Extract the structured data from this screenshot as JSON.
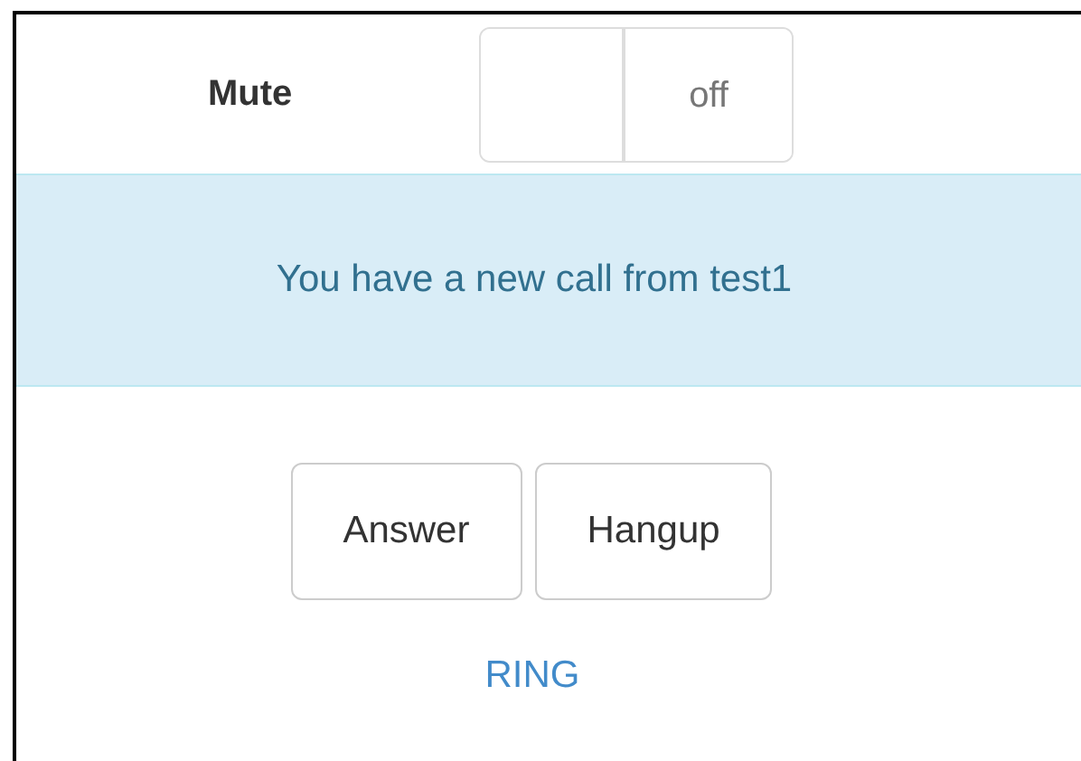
{
  "mute": {
    "label": "Mute",
    "toggle": {
      "on": false,
      "state_label": "off"
    }
  },
  "alert": {
    "message": "You have a new call from test1"
  },
  "buttons": [
    "Answer",
    "Hangup"
  ],
  "status": "RING"
}
